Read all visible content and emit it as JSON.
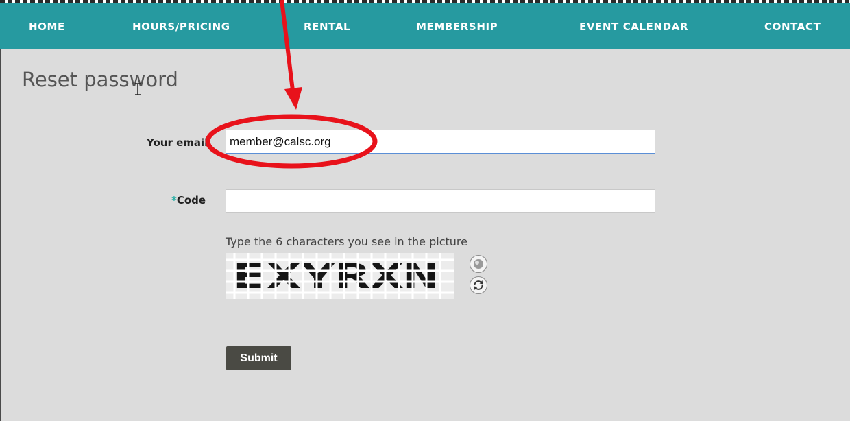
{
  "nav": {
    "items": [
      "HOME",
      "HOURS/PRICING",
      "RENTAL",
      "MEMBERSHIP",
      "EVENT CALENDAR",
      "CONTACT"
    ]
  },
  "page": {
    "title": "Reset password"
  },
  "form": {
    "email_label": "Your email",
    "email_value": "member@calsc.org",
    "code_required_mark": "*",
    "code_label": "Code",
    "code_value": "",
    "captcha_hint": "Type the 6 characters you see in the picture",
    "captcha_text": "EXYRXN",
    "submit_label": "Submit"
  },
  "icons": {
    "audio": "speaker-icon",
    "refresh": "refresh-icon",
    "cursor": "text-cursor-icon"
  },
  "colors": {
    "nav_bg": "#269aa0",
    "content_bg": "#dcdcdc",
    "annotation": "#e8121b",
    "submit_bg": "#4a4a44",
    "required_star": "#2bb0a6"
  }
}
